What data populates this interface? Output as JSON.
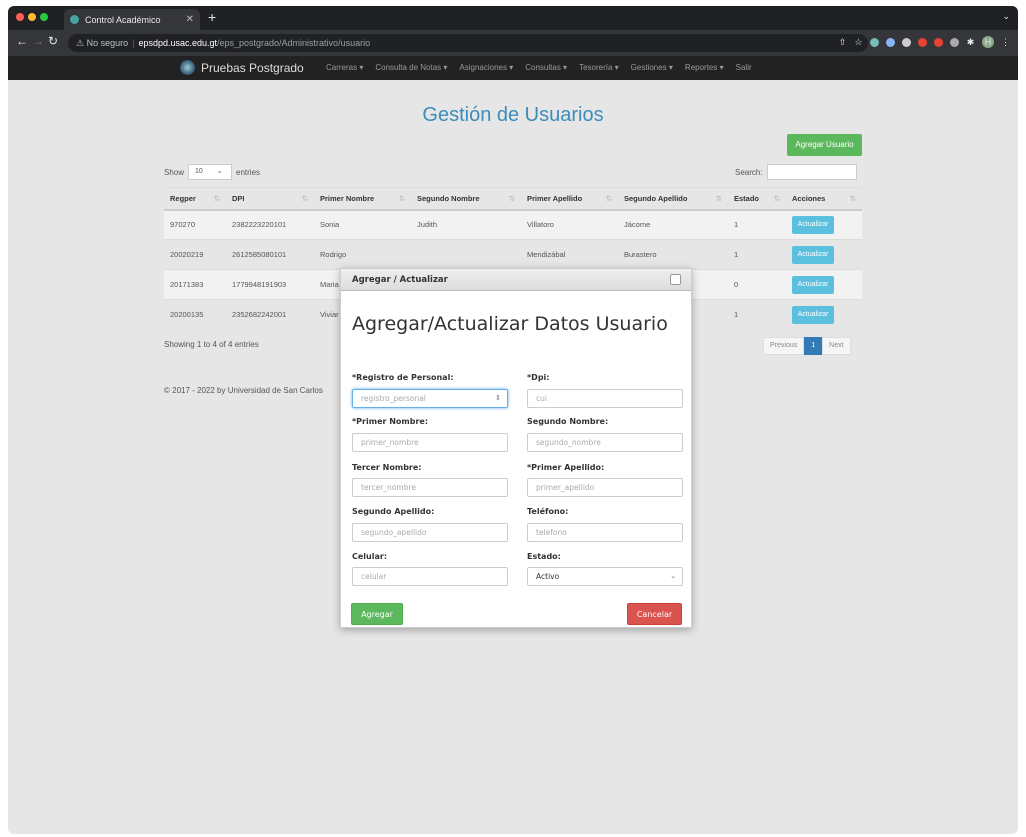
{
  "browser": {
    "tab_title": "Control Académico",
    "address_security": "⚠ No seguro",
    "address_host": "epsdpd.usac.edu.gt",
    "address_path": "/eps_postgrado/Administrativo/usuario",
    "profile_initial": "H"
  },
  "appnav": {
    "brand": "Pruebas Postgrado",
    "menu": [
      "Carreras ▾",
      "Consulta de Notas ▾",
      "Asignaciones ▾",
      "Consultas ▾",
      "Tesorería ▾",
      "Gestiones ▾",
      "Reportes ▾",
      "Salir"
    ]
  },
  "page": {
    "title": "Gestión de Usuarios",
    "add_button": "Agregar Usuario",
    "show_label": "Show",
    "entries_value": "10",
    "entries_label": "entries",
    "search_label": "Search:",
    "info": "Showing 1 to 4 of 4 entries",
    "pager": {
      "previous": "Previous",
      "current": "1",
      "next": "Next"
    },
    "footer": "© 2017 - 2022 by Universidad de San Carlos"
  },
  "table": {
    "headers": [
      "Regper",
      "DPI",
      "Primer Nombre",
      "Segundo Nombre",
      "Primer Apellido",
      "Segundo Apellido",
      "Estado",
      "Acciones"
    ],
    "rows": [
      [
        "970270",
        "2382223220101",
        "Sonia",
        "Judith",
        "Villatoro",
        "Jácome",
        "1",
        "Actualizar"
      ],
      [
        "20020219",
        "2612585080101",
        "Rodrigo",
        "",
        "Mendizábal",
        "Burastero",
        "1",
        "Actualizar"
      ],
      [
        "20171383",
        "1779948191903",
        "Maria",
        "",
        "",
        "",
        "0",
        "Actualizar"
      ],
      [
        "20200135",
        "2352682242001",
        "Viviar",
        "",
        "",
        "",
        "1",
        "Actualizar"
      ]
    ]
  },
  "modal": {
    "header": "Agregar / Actualizar",
    "title": "Agregar/Actualizar Datos Usuario",
    "fields": {
      "registro_label": "*Registro de Personal:",
      "registro_placeholder": "registro_personal",
      "dpi_label": "*Dpi:",
      "dpi_placeholder": "cui",
      "primer_nombre_label": "*Primer Nombre:",
      "primer_nombre_placeholder": "primer_nombre",
      "segundo_nombre_label": "Segundo Nombre:",
      "segundo_nombre_placeholder": "segundo_nombre",
      "tercer_nombre_label": "Tercer Nombre:",
      "tercer_nombre_placeholder": "tercer_nombre",
      "primer_apellido_label": "*Primer Apellido:",
      "primer_apellido_placeholder": "primer_apellido",
      "segundo_apellido_label": "Segundo Apellido:",
      "segundo_apellido_placeholder": "segundo_apellido",
      "telefono_label": "Teléfono:",
      "telefono_placeholder": "telefono",
      "celular_label": "Celular:",
      "celular_placeholder": "celular",
      "estado_label": "Estado:",
      "estado_value": "Activo"
    },
    "submit": "Agregar",
    "cancel": "Cancelar"
  }
}
